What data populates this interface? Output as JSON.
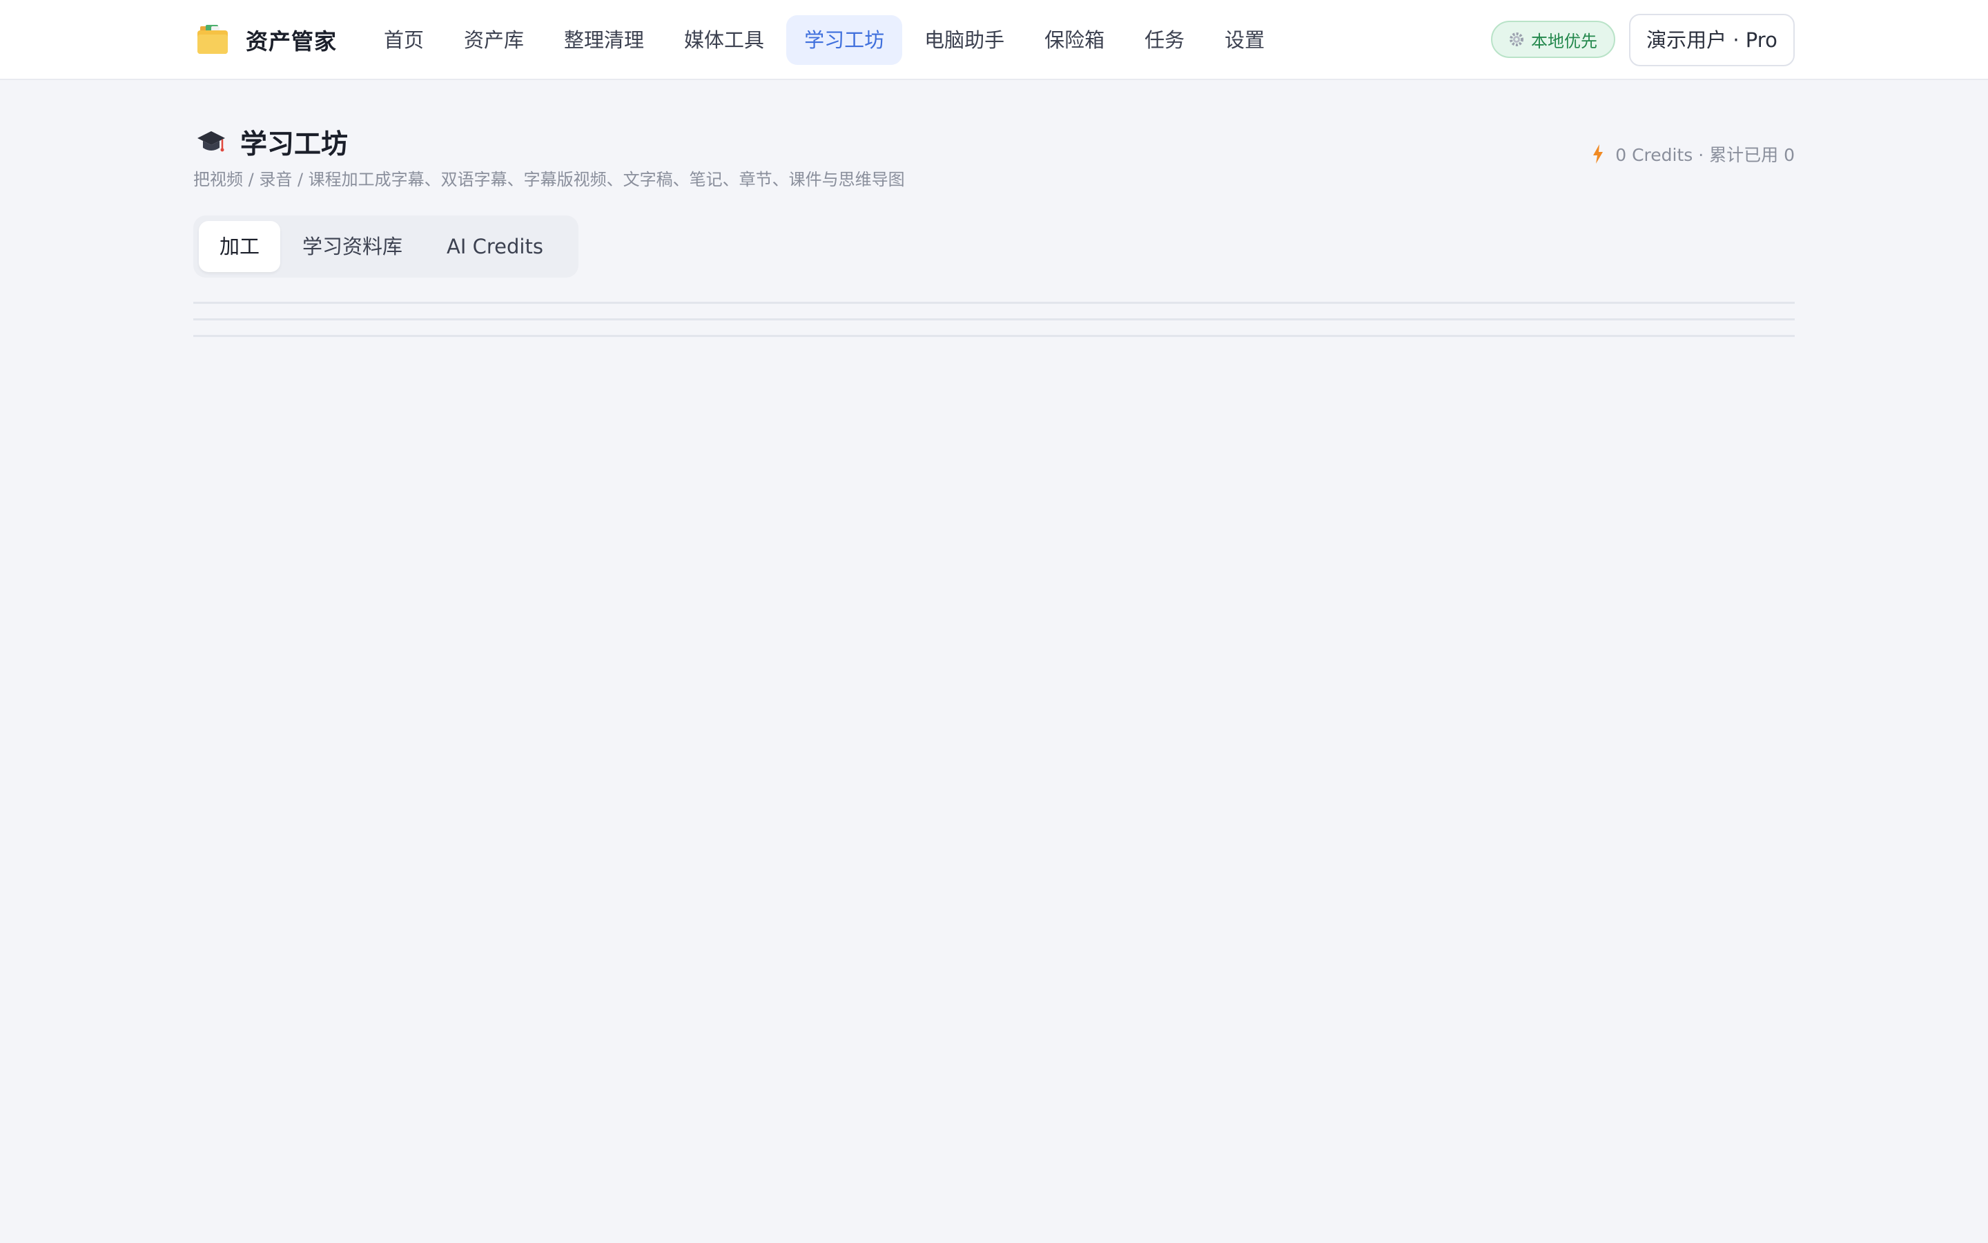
{
  "app": {
    "title": "资产管家"
  },
  "nav": {
    "items": [
      {
        "label": "首页"
      },
      {
        "label": "资产库"
      },
      {
        "label": "整理清理"
      },
      {
        "label": "媒体工具"
      },
      {
        "label": "学习工坊",
        "active": true
      },
      {
        "label": "电脑助手"
      },
      {
        "label": "保险箱"
      },
      {
        "label": "任务"
      },
      {
        "label": "设置"
      }
    ]
  },
  "header": {
    "local_badge": "本地优先",
    "user_button": "演示用户 · Pro"
  },
  "page": {
    "title": "学习工坊",
    "subtitle": "把视频 / 录音 / 课程加工成字幕、双语字幕、字幕版视频、文字稿、笔记、章节、课件与思维导图",
    "credits": "0 Credits · 累计已用 0"
  },
  "tabs": [
    {
      "label": "加工",
      "active": true
    },
    {
      "label": "学习资料库"
    },
    {
      "label": "AI Credits"
    }
  ],
  "colors": {
    "accent": "#3f6fdc",
    "accent_bg": "#eaf0ff",
    "success": "#23884c",
    "page_bg": "#f4f5f9"
  },
  "icons": {
    "brand": "folder-icon",
    "page": "graduation-cap-icon",
    "credits": "lightning-bolt-icon",
    "local": "gear-icon"
  }
}
